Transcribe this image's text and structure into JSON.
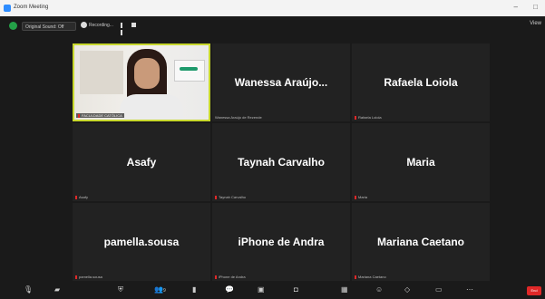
{
  "window": {
    "title": "Zoom Meeting",
    "logo_icon": "zoom-icon",
    "min_glyph": "–",
    "max_glyph": "□"
  },
  "topbar": {
    "original_sound": "Original Sound: Off",
    "recording": "Recording...",
    "view_label": "View"
  },
  "tiles": [
    {
      "display_name": "",
      "label": "FACULDADE CATÓLICA",
      "video": true
    },
    {
      "display_name": "Wanessa  Araújo...",
      "label": "Wanessa Araújo de Rezende",
      "video": false
    },
    {
      "display_name": "Rafaela Loiola",
      "label": "Rafaela Loiola",
      "video": false
    },
    {
      "display_name": "Asafy",
      "label": "Asafy",
      "video": false
    },
    {
      "display_name": "Taynah Carvalho",
      "label": "Taynah Carvalho",
      "video": false
    },
    {
      "display_name": "Maria",
      "label": "Maria",
      "video": false
    },
    {
      "display_name": "pamella.sousa",
      "label": "pamella.sousa",
      "video": false
    },
    {
      "display_name": "iPhone de Andra",
      "label": "iPhone de Andra",
      "video": false
    },
    {
      "display_name": "Mariana Caetano",
      "label": "Mariana Caetano",
      "video": false
    }
  ],
  "toolbar": {
    "participants_count": "9",
    "end_label": "End"
  },
  "colors": {
    "active_border": "#c8d82d",
    "end_button": "#e02828",
    "muted_mic": "#e02828"
  }
}
